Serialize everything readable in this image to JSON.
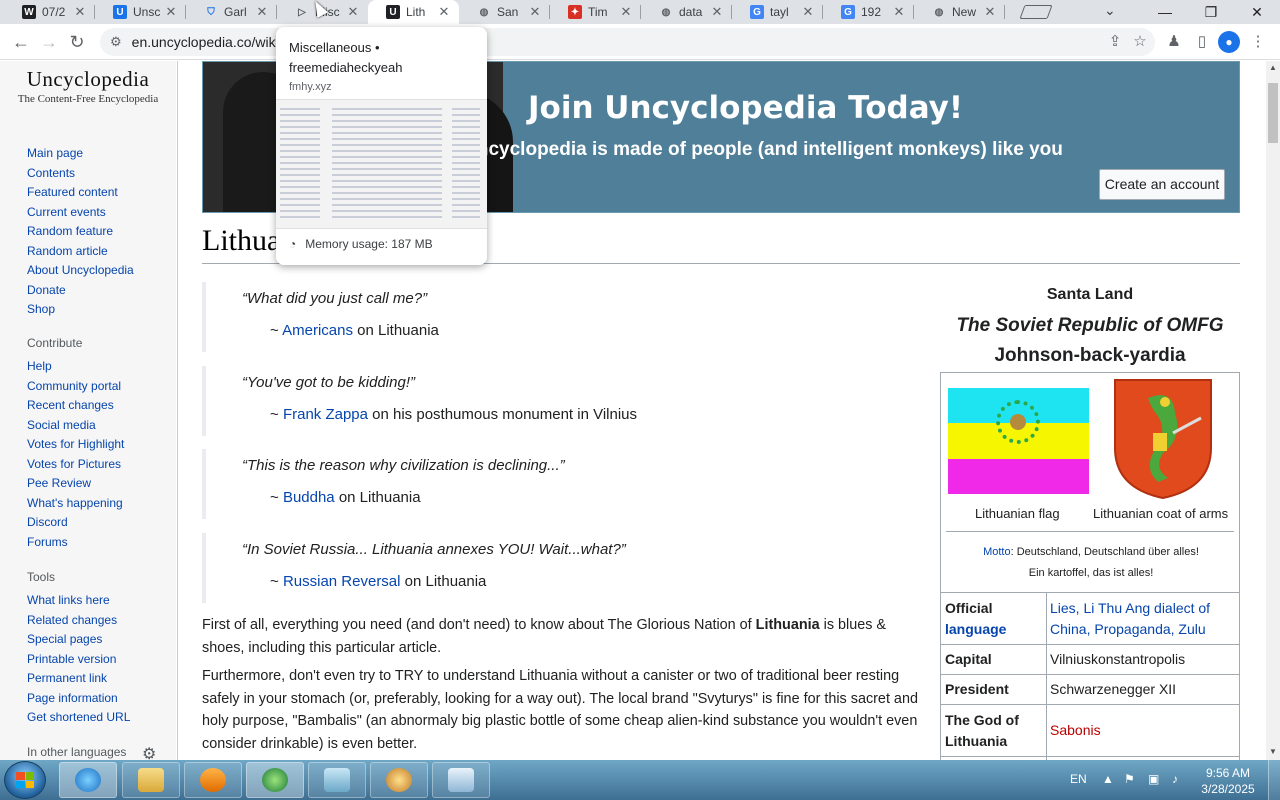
{
  "browser": {
    "tabs": [
      {
        "title": "07/2",
        "icon": "wiki-w-icon",
        "color": "#202124",
        "glyph": "W"
      },
      {
        "title": "Unsc",
        "icon": "uncyclopedia-icon",
        "color": "#1a73e8",
        "glyph": "U"
      },
      {
        "title": "Garl",
        "icon": "shield-icon",
        "color": "#1a73e8",
        "glyph": "⛉"
      },
      {
        "title": "Misc",
        "icon": "play-icon",
        "color": "#5f6368",
        "glyph": "▷"
      },
      {
        "title": "Lith",
        "icon": "uncyclopedia-icon",
        "color": "#202124",
        "glyph": "U"
      },
      {
        "title": "San",
        "icon": "globe-icon",
        "color": "#5f6368",
        "glyph": "◍"
      },
      {
        "title": "Tim",
        "icon": "timeline-icon",
        "color": "#d93025",
        "glyph": "✦"
      },
      {
        "title": "data",
        "icon": "globe-icon",
        "color": "#5f6368",
        "glyph": "◍"
      },
      {
        "title": "tayl",
        "icon": "google-icon",
        "color": "#4285f4",
        "glyph": "G"
      },
      {
        "title": "192",
        "icon": "google-icon",
        "color": "#4285f4",
        "glyph": "G"
      },
      {
        "title": "New",
        "icon": "chrome-icon",
        "color": "#5f6368",
        "glyph": "◍"
      }
    ],
    "url": "en.uncyclopedia.co/wik",
    "window_buttons": [
      "—",
      "❐",
      "✕"
    ]
  },
  "hover_card": {
    "title": "Miscellaneous • freemediaheckyeah",
    "domain": "fmhy.xyz",
    "memory": "Memory usage: 187 MB"
  },
  "sidebar": {
    "logo_name": "Uncyclopedia",
    "logo_tagline": "The Content-Free Encyclopedia",
    "navigation": [
      "Main page",
      "Contents",
      "Featured content",
      "Current events",
      "Random feature",
      "Random article",
      "About Uncyclopedia",
      "Donate",
      "Shop"
    ],
    "contribute_heading": "Contribute",
    "contribute": [
      "Help",
      "Community portal",
      "Recent changes",
      "Social media",
      "Votes for Highlight",
      "Votes for Pictures",
      "Pee Review",
      "What's happening",
      "Discord",
      "Forums"
    ],
    "tools_heading": "Tools",
    "tools": [
      "What links here",
      "Related changes",
      "Special pages",
      "Printable version",
      "Permanent link",
      "Page information",
      "Get shortened URL"
    ],
    "languages_heading": "In other languages"
  },
  "banner": {
    "title": "Join Uncyclopedia Today!",
    "subtitle": "Uncyclopedia is made of people (and intelligent monkeys) like you",
    "button": "Create an account"
  },
  "article": {
    "title": "Lithuania",
    "quotes": [
      {
        "quote": "“What did you just call me?”",
        "link": "Americans",
        "rest": " on Lithuania"
      },
      {
        "quote": "“You've got to be kidding!”",
        "link": "Frank Zappa",
        "rest": " on his posthumous monument in Vilnius"
      },
      {
        "quote": "“This is the reason why civilization is declining...”",
        "link": "Buddha",
        "rest": " on Lithuania"
      },
      {
        "quote": "“In Soviet Russia... Lithuania annexes YOU! Wait...what?”",
        "link": "Russian Reversal",
        "rest": " on Lithuania"
      }
    ],
    "para1_a": "First of all, everything you need (and don't need) to know about The Glorious Nation of ",
    "para1_b": "Lithuania",
    "para1_c": " is blues & shoes, including this particular article.",
    "para2": "Furthermore, don't even try to TRY to understand Lithuania without a canister or two of traditional beer resting safely in your stomach (or, preferably, looking for a way out). The local brand \"Svyturys\" is fine for this sacret and holy purpose, \"Bambalis\" (an abnormaly big plastic bottle of some cheap alien-kind substance you wouldn't even consider drinkable) is even better."
  },
  "infobox": {
    "name1": "Santa Land",
    "name2": "The Soviet Republic of OMFG",
    "name3": "Johnson-back-yardia",
    "flag_caption": "Lithuanian flag",
    "coa_caption": "Lithuanian coat of arms",
    "flag_colors": [
      "#1ee3f0",
      "#f6f600",
      "#f028e8"
    ],
    "motto_label": "Motto",
    "motto_line1": "Deutschland, Deutschland über alles!",
    "motto_line2": "Ein kartoffel, das ist alles!",
    "rows": [
      {
        "key": "Official language",
        "value": "Lies, Li Thu Ang dialect of China, Propaganda, Zulu"
      },
      {
        "key": "Capital",
        "value": "Vilniuskonstantropolis"
      },
      {
        "key": "President",
        "value": "Schwarzenegger XII"
      },
      {
        "key": "The God of Lithuania",
        "value": "Sabonis"
      }
    ]
  },
  "taskbar": {
    "lang": "EN",
    "time": "9:56 AM",
    "date": "3/28/2025"
  }
}
